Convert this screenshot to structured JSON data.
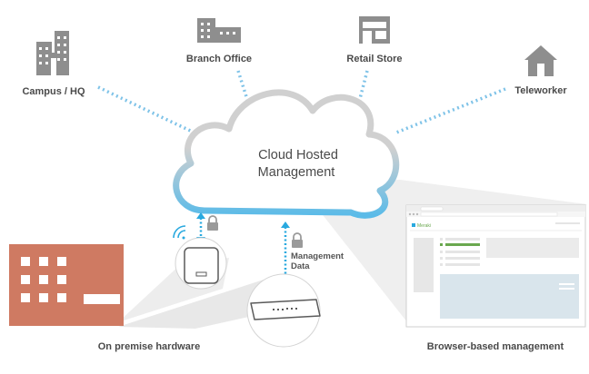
{
  "sites": {
    "campus": "Campus / HQ",
    "branch": "Branch Office",
    "retail": "Retail Store",
    "teleworker": "Teleworker"
  },
  "cloud": {
    "line1": "Cloud Hosted",
    "line2": "Management"
  },
  "management_data": {
    "line1": "Management",
    "line2": "Data"
  },
  "captions": {
    "hardware": "On premise hardware",
    "browser": "Browser-based management"
  },
  "browser_mock": {
    "brand": "Meraki"
  },
  "colors": {
    "building_icon": "#8e8e8e",
    "dashes": "#7fc3e8",
    "cloud_stroke": "#8fd0ee",
    "arrow": "#29a9df",
    "on_prem_building": "#cf7a62",
    "window_white": "#ffffff",
    "beam": "#e9e9e9",
    "brand_green": "#6aa84f",
    "mock_blue": "#d9e5ec"
  },
  "icons": [
    "campus-building-icon",
    "branch-office-icon",
    "retail-store-icon",
    "teleworker-house-icon",
    "lock-icon",
    "wifi-icon",
    "access-point-icon",
    "switch-appliance-icon"
  ]
}
